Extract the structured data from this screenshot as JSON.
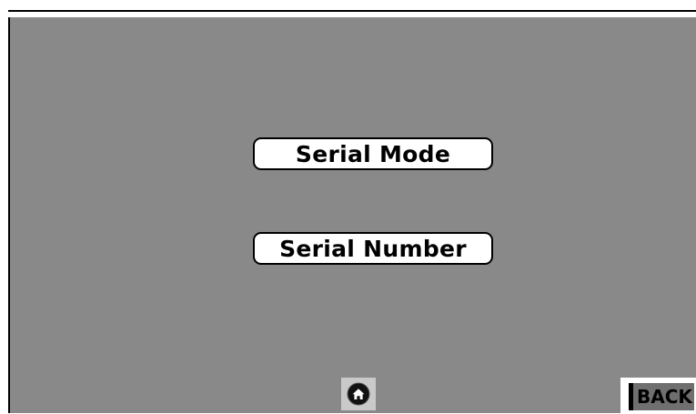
{
  "menu": {
    "serial_mode_label": "Serial Mode",
    "serial_number_label": "Serial Number"
  },
  "nav": {
    "home_icon": "home-icon",
    "back_label": "BACK"
  },
  "colors": {
    "panel_background": "#898989",
    "button_background": "#ffffff",
    "home_button_background": "#c9c9c9",
    "back_button_face": "#6f6f6f"
  }
}
